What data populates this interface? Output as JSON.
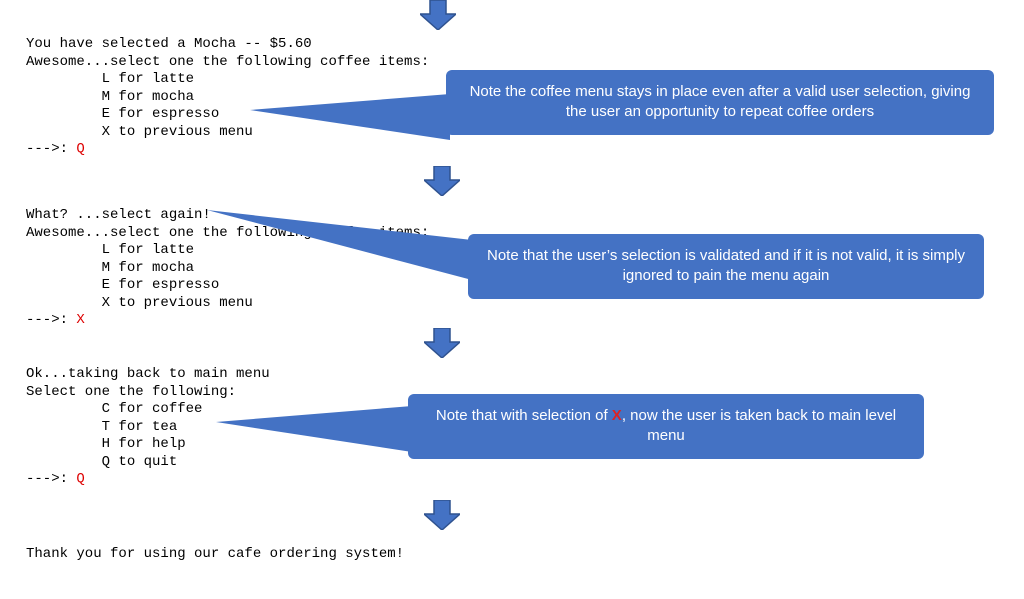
{
  "blocks": {
    "b1": {
      "line1": "You have selected a Mocha -- $5.60",
      "line2": "Awesome...select one the following coffee items:",
      "opt1": "         L for latte",
      "opt2": "         M for mocha",
      "opt3": "         E for espresso",
      "opt4": "         X to previous menu",
      "prompt": "--->: ",
      "input": "Q"
    },
    "b2": {
      "line1": "What? ...select again!",
      "line2": "Awesome...select one the following coffee items:",
      "opt1": "         L for latte",
      "opt2": "         M for mocha",
      "opt3": "         E for espresso",
      "opt4": "         X to previous menu",
      "prompt": "--->: ",
      "input": "X"
    },
    "b3": {
      "line1": "Ok...taking back to main menu",
      "line2": "Select one the following:",
      "opt1": "         C for coffee",
      "opt2": "         T for tea",
      "opt3": "         H for help",
      "opt4": "         Q to quit",
      "prompt": "--->: ",
      "input": "Q"
    },
    "b4": {
      "line1": "Thank you for using our cafe ordering system!"
    }
  },
  "callouts": {
    "c1": "Note the coffee menu stays in place even after a valid user selection, giving the user an opportunity to repeat coffee orders",
    "c2": "Note that the user’s selection is validated and if it is not valid, it is simply ignored to pain the menu again",
    "c3_pre": "Note that with selection of ",
    "c3_x": "X",
    "c3_post": ", now the user is taken back to main level menu"
  },
  "colors": {
    "callout_bg": "#4472c4",
    "arrow_fill": "#4472c4",
    "arrow_stroke": "#2f528f"
  }
}
